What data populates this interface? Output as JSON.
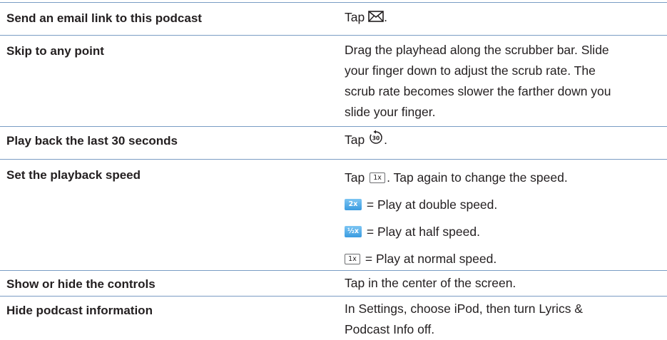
{
  "rows": [
    {
      "task": "Send an email link to this podcast",
      "action": {
        "before": "Tap ",
        "after": "."
      }
    },
    {
      "task": "Skip to any point",
      "action_lines": [
        "Drag the playhead along the scrubber bar. Slide",
        "your finger down to adjust the scrub rate. The",
        "scrub rate becomes slower the farther down you",
        "slide your finger."
      ]
    },
    {
      "task": "Play back the last 30 seconds",
      "action": {
        "before": "Tap ",
        "after": "."
      }
    },
    {
      "task": "Set the playback speed",
      "action_line1": {
        "before": "Tap ",
        "badge": "1x",
        "after": ". Tap again to change the speed."
      },
      "options": [
        {
          "badge": "2x",
          "text": " = Play at double speed."
        },
        {
          "badge": "½x",
          "text": " = Play at half speed."
        },
        {
          "badge": "1x",
          "text": " = Play at normal speed."
        }
      ]
    },
    {
      "task": "Show or hide the controls",
      "action": "Tap in the center of the screen."
    },
    {
      "task": "Hide podcast information",
      "action_lines": [
        "In Settings, choose iPod, then turn Lyrics &",
        "Podcast Info off."
      ]
    }
  ],
  "icons": {
    "email": "envelope-icon",
    "back30": "rewind-30-seconds-icon"
  },
  "colors": {
    "rule": "#7a9cc4",
    "text": "#231f20",
    "badge_blue": "#3a9be0"
  }
}
